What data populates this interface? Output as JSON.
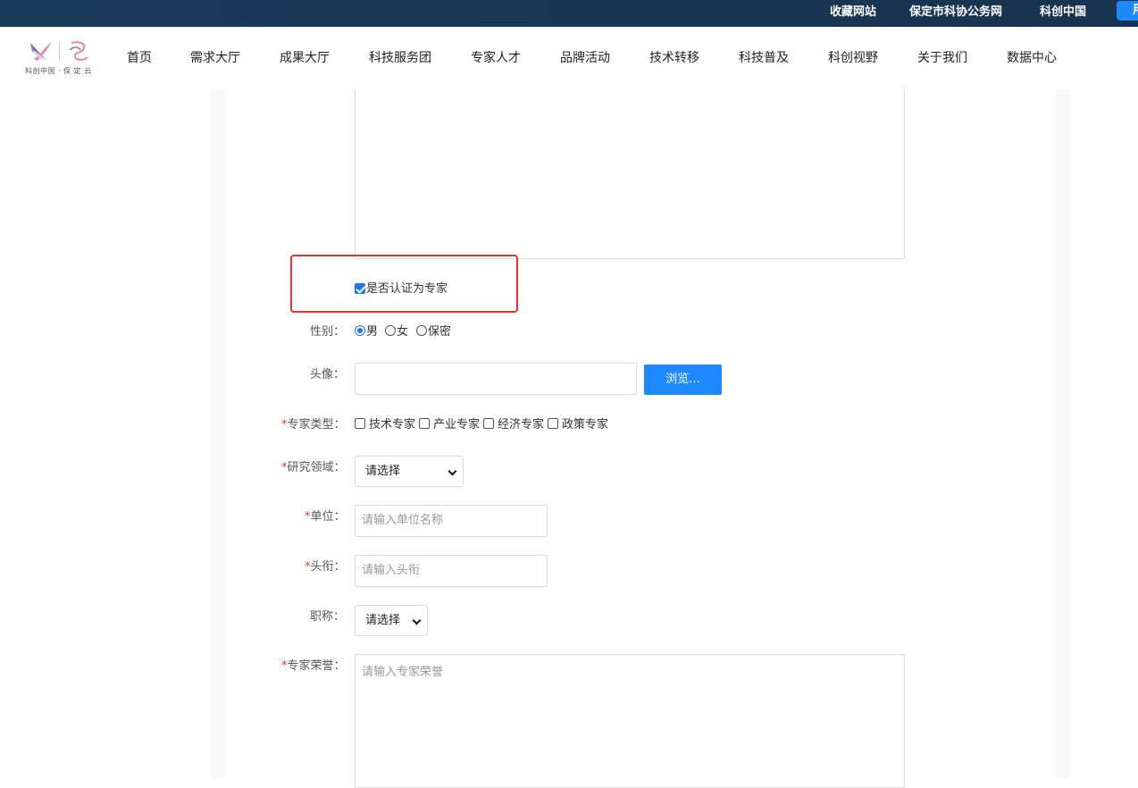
{
  "topbar": {
    "links": [
      "收藏网站",
      "保定市科协公务网",
      "科创中国"
    ],
    "login_label": "用"
  },
  "logo": {
    "text": "科创中国 · 保 定 云"
  },
  "nav": [
    "首页",
    "需求大厅",
    "成果大厅",
    "科技服务团",
    "专家人才",
    "品牌活动",
    "技术转移",
    "科技普及",
    "科创视野",
    "关于我们",
    "数据中心"
  ],
  "form": {
    "certify_label": "是否认证为专家",
    "certify_checked": true,
    "gender": {
      "label": "性别：",
      "options": [
        "男",
        "女",
        "保密"
      ],
      "selected": "男"
    },
    "avatar": {
      "label": "头像：",
      "browse_label": "浏览..."
    },
    "expert_type": {
      "required": "*",
      "label": "专家类型：",
      "options": [
        "技术专家",
        "产业专家",
        "经济专家",
        "政策专家"
      ]
    },
    "research_field": {
      "required": "*",
      "label": "研究领域：",
      "value": "请选择"
    },
    "unit": {
      "required": "*",
      "label": "单位：",
      "placeholder": "请输入单位名称"
    },
    "title": {
      "required": "*",
      "label": "头衔：",
      "placeholder": "请输入头衔"
    },
    "job_title": {
      "label": "职称：",
      "value": "请选择"
    },
    "honors": {
      "required": "*",
      "label": "专家荣誉：",
      "placeholder": "请输入专家荣誉"
    }
  },
  "colors": {
    "accent": "#1e88ff",
    "highlight": "#e8322f",
    "topbar": "#1a3a5c"
  }
}
